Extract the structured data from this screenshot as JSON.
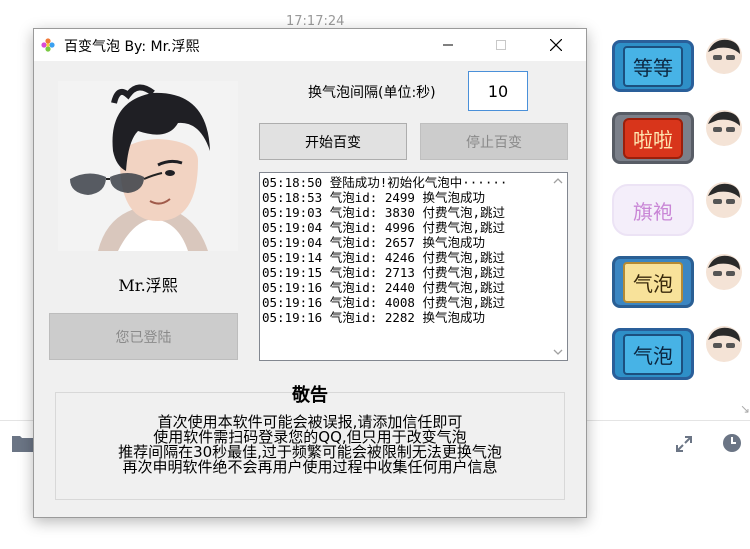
{
  "background": {
    "time": "17:17:24",
    "bubbles": [
      {
        "text": "等等"
      },
      {
        "text": "啦啦"
      },
      {
        "text": "旗袍"
      },
      {
        "text": "气泡"
      },
      {
        "text": "气泡"
      }
    ]
  },
  "window": {
    "title": "百变气泡   By:  Mr.浮熙",
    "controls": {
      "minimize": "minimize",
      "maximize": "maximize",
      "close": "close"
    }
  },
  "profile": {
    "name": "Mr.浮熙",
    "login_button": "您已登陆"
  },
  "controls": {
    "interval_label": "换气泡间隔(单位:秒)",
    "interval_value": "10",
    "start_button": "开始百变",
    "stop_button": "停止百变"
  },
  "log": [
    "05:18:50 登陆成功!初始化气泡中······",
    "05:18:53 气泡id: 2499 换气泡成功",
    "05:19:03 气泡id: 3830 付费气泡,跳过",
    "05:19:04 气泡id: 4996 付费气泡,跳过",
    "05:19:04 气泡id: 2657 换气泡成功",
    "05:19:14 气泡id: 4246 付费气泡,跳过",
    "05:19:15 气泡id: 2713 付费气泡,跳过",
    "05:19:16 气泡id: 2440 付费气泡,跳过",
    "05:19:16 气泡id: 4008 付费气泡,跳过",
    "05:19:16 气泡id: 2282 换气泡成功"
  ],
  "notice": {
    "title": "敬告",
    "lines": [
      "首次使用本软件可能会被误报,请添加信任即可",
      "使用软件需扫码登录您的QQ,但只用于改变气泡",
      "推荐间隔在30秒最佳,过于频繁可能会被限制无法更换气泡",
      "再次申明软件绝不会再用户使用过程中收集任何用户信息"
    ]
  },
  "colors": {
    "accent_input_border": "#4a90d9",
    "window_bg": "#f0f0f0",
    "disabled_button": "#cccccc"
  }
}
